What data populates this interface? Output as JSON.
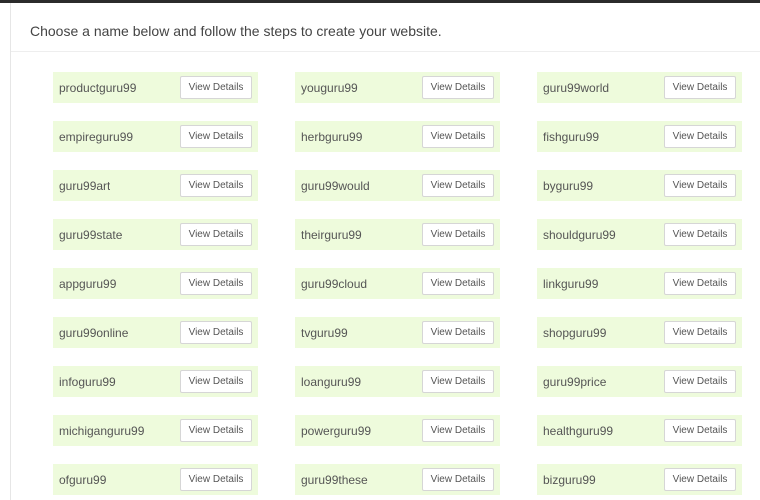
{
  "intro_text": "Choose a name below and follow the steps to create your website.",
  "button_label": "View Details",
  "names": [
    "productguru99",
    "youguru99",
    "guru99world",
    "empireguru99",
    "herbguru99",
    "fishguru99",
    "guru99art",
    "guru99would",
    "byguru99",
    "guru99state",
    "theirguru99",
    "shouldguru99",
    "appguru99",
    "guru99cloud",
    "linkguru99",
    "guru99online",
    "tvguru99",
    "shopguru99",
    "infoguru99",
    "loanguru99",
    "guru99price",
    "michiganguru99",
    "powerguru99",
    "healthguru99",
    "ofguru99",
    "guru99these",
    "bizguru99"
  ]
}
